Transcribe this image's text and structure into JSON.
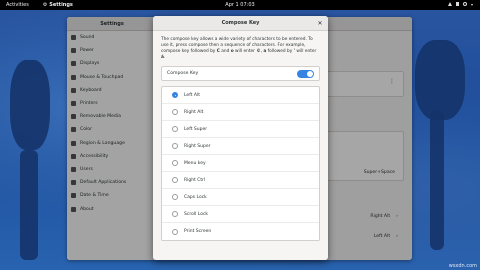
{
  "topbar": {
    "activities": "Activities",
    "app_name": "Settings",
    "clock": "Apr 1  07:03"
  },
  "settings": {
    "title": "Settings",
    "sidebar": [
      {
        "label": "Sound",
        "icon": "sound-icon"
      },
      {
        "label": "Power",
        "icon": "power-icon"
      },
      {
        "label": "Displays",
        "icon": "display-icon"
      },
      {
        "label": "Mouse & Touchpad",
        "icon": "mouse-icon"
      },
      {
        "label": "Keyboard",
        "icon": "keyboard-icon"
      },
      {
        "label": "Printers",
        "icon": "printer-icon"
      },
      {
        "label": "Removable Media",
        "icon": "media-icon"
      },
      {
        "label": "Color",
        "icon": "color-icon"
      },
      {
        "label": "Region & Language",
        "icon": "region-icon"
      },
      {
        "label": "Accessibility",
        "icon": "accessibility-icon"
      },
      {
        "label": "Users",
        "icon": "users-icon"
      },
      {
        "label": "Default Applications",
        "icon": "star-icon"
      },
      {
        "label": "Date & Time",
        "icon": "clock-icon"
      },
      {
        "label": "About",
        "icon": "info-icon"
      }
    ],
    "shortcut_value": "Super+Space",
    "row1_value": "Right Alt",
    "row2_value": "Left Alt"
  },
  "dialog": {
    "title": "Compose Key",
    "description_prefix": "The compose key allows a wide variety of characters to be entered. To use it, press compose then a sequence of characters. For example, compose key followed by ",
    "desc_key_c": "C",
    "desc_and": " and ",
    "desc_key_o": "o",
    "desc_will_enter": " will enter ",
    "desc_copyright": "©",
    "desc_comma": ", ",
    "desc_key_a": "a",
    "desc_followed": " followed by ",
    "desc_apos": "'",
    "desc_will_enter2": " will enter ",
    "desc_aacute": "á",
    "desc_period": ".",
    "toggle_label": "Compose Key",
    "toggle_on": true,
    "options": [
      {
        "label": "Left Alt",
        "selected": true
      },
      {
        "label": "Right Alt",
        "selected": false
      },
      {
        "label": "Left Super",
        "selected": false
      },
      {
        "label": "Right Super",
        "selected": false
      },
      {
        "label": "Menu key",
        "selected": false
      },
      {
        "label": "Right Ctrl",
        "selected": false
      },
      {
        "label": "Caps Lock",
        "selected": false
      },
      {
        "label": "Scroll Lock",
        "selected": false
      },
      {
        "label": "Print Screen",
        "selected": false
      }
    ]
  },
  "watermark": "wsxdn.com",
  "colors": {
    "accent": "#3584e4",
    "topbar": "#000000"
  }
}
